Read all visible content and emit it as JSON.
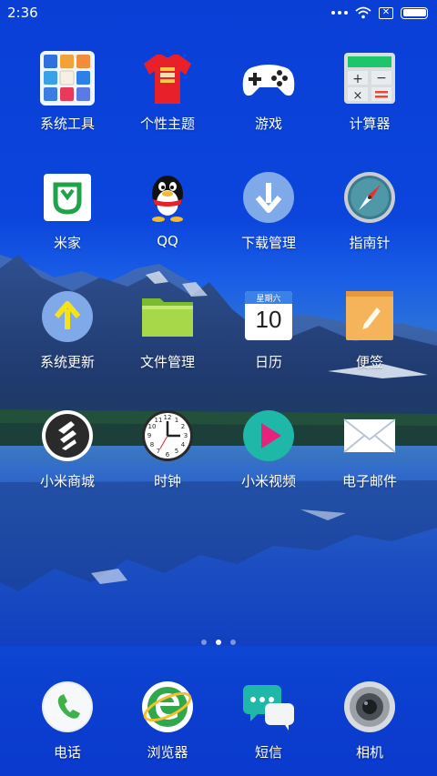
{
  "status_bar": {
    "time": "2:36"
  },
  "apps": [
    {
      "label": "系统工具",
      "icon": "system-tools-folder-icon"
    },
    {
      "label": "个性主题",
      "icon": "theme-tshirt-icon"
    },
    {
      "label": "游戏",
      "icon": "gamepad-icon"
    },
    {
      "label": "计算器",
      "icon": "calculator-icon"
    },
    {
      "label": "米家",
      "icon": "mijia-icon"
    },
    {
      "label": "QQ",
      "icon": "qq-penguin-icon"
    },
    {
      "label": "下载管理",
      "icon": "download-arrow-icon"
    },
    {
      "label": "指南针",
      "icon": "compass-icon"
    },
    {
      "label": "系统更新",
      "icon": "update-arrow-icon"
    },
    {
      "label": "文件管理",
      "icon": "folder-icon"
    },
    {
      "label": "日历",
      "icon": "calendar-icon"
    },
    {
      "label": "便签",
      "icon": "notes-icon"
    },
    {
      "label": "小米商城",
      "icon": "mi-store-icon"
    },
    {
      "label": "时钟",
      "icon": "clock-icon"
    },
    {
      "label": "小米视频",
      "icon": "video-play-icon"
    },
    {
      "label": "电子邮件",
      "icon": "mail-envelope-icon"
    }
  ],
  "calendar_icon": {
    "weekday": "星期六",
    "day": "10"
  },
  "page_indicator": {
    "pages": 3,
    "active": 2
  },
  "dock": [
    {
      "label": "电话",
      "icon": "phone-icon"
    },
    {
      "label": "浏览器",
      "icon": "browser-icon"
    },
    {
      "label": "短信",
      "icon": "messages-icon"
    },
    {
      "label": "相机",
      "icon": "camera-icon"
    }
  ],
  "colors": {
    "wallpaper_sky": "#0b45dc",
    "lake": "#2c63c7",
    "tshirt_red": "#e8202a",
    "download_blue": "#7fa9e8",
    "update_yellow": "#f5e11e",
    "folder_green": "#a6d84a",
    "notes_orange": "#f6b45a",
    "video_pink": "#e8227c",
    "video_teal": "#1fb7a7",
    "mijia_green": "#1ea24a"
  }
}
